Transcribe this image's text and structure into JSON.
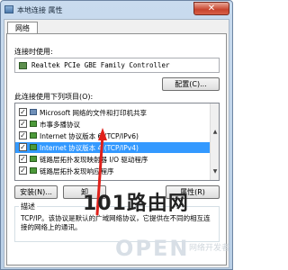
{
  "window": {
    "title": "本地连接 属性",
    "close": "✕"
  },
  "tabs": [
    {
      "label": "网络"
    }
  ],
  "connect_using": {
    "label": "连接时使用:",
    "adapter": "Realtek PCIe GBE Family Controller",
    "configure_button": "配置(C)..."
  },
  "items_label": "此连接使用下列项目(O):",
  "items": [
    {
      "label": "Microsoft 网络的文件和打印机共享",
      "checked": true,
      "selected": false,
      "icon": "network-client-icon"
    },
    {
      "label": "市事多播协议",
      "checked": true,
      "selected": false,
      "icon": "protocol-icon"
    },
    {
      "label": "Internet 协议版本 6 (TCP/IPv6)",
      "checked": true,
      "selected": false,
      "icon": "protocol-icon"
    },
    {
      "label": "Internet 协议版本 4 (TCP/IPv4)",
      "checked": true,
      "selected": true,
      "icon": "protocol-icon"
    },
    {
      "label": "链路层拓扑发现映射器 I/O 驱动程序",
      "checked": true,
      "selected": false,
      "icon": "protocol-icon"
    },
    {
      "label": "链路层拓扑发现响应程序",
      "checked": true,
      "selected": false,
      "icon": "protocol-icon"
    }
  ],
  "buttons": {
    "install": "安装(N)...",
    "uninstall": "卸",
    "properties": "属性(R)"
  },
  "description": {
    "title": "描述",
    "text": "TCP/IP。该协议是默认的广域网络协议，它提供在不同的相互连接的网络上的通讯。"
  },
  "watermarks": {
    "w1": "101路由网",
    "w2": "OPEN",
    "w3": "网络开发者"
  },
  "colors": {
    "selection": "#3399ff",
    "arrow": "#e0201a"
  }
}
